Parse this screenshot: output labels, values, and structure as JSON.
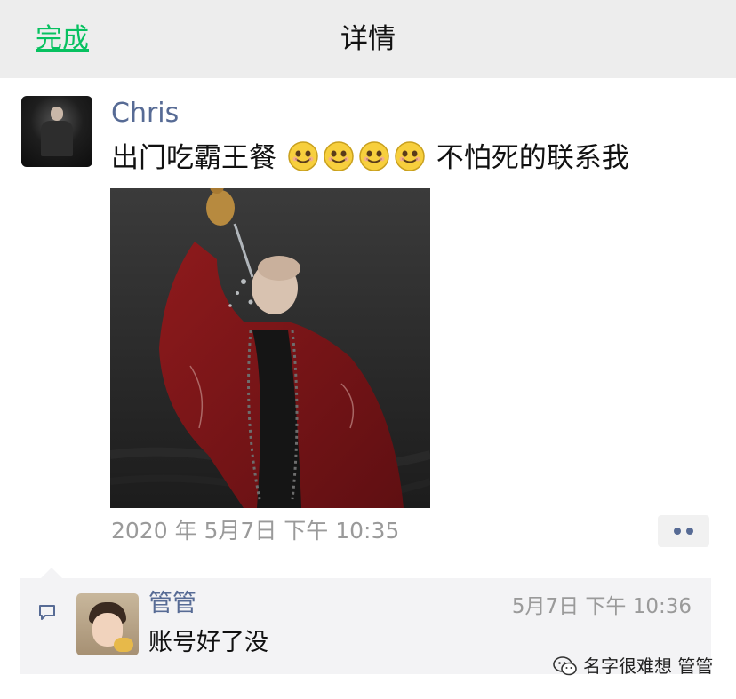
{
  "navbar": {
    "done_label": "完成",
    "title": "详情"
  },
  "post": {
    "author": "Chris",
    "text_before": "出门吃霸王餐",
    "text_after": "不怕死的联系我",
    "emojis": [
      "smile-emoji",
      "smile-emoji",
      "smile-emoji",
      "smile-emoji"
    ],
    "timestamp": "2020 年 5月7日 下午 10:35"
  },
  "comment": {
    "author": "管管",
    "time": "5月7日 下午 10:36",
    "text": "账号好了没"
  },
  "watermark": {
    "text": "名字很难想 管管"
  },
  "colors": {
    "accent_green": "#07c160",
    "link_blue": "#576b95",
    "navbar_bg": "#ededed",
    "comment_bg": "#f3f3f5",
    "meta_gray": "#9a9a9a"
  },
  "icons": {
    "done": "text-link",
    "more": "two-dot-more-icon",
    "comment": "comment-bubble-icon",
    "watermark": "wechat-logo-icon"
  }
}
